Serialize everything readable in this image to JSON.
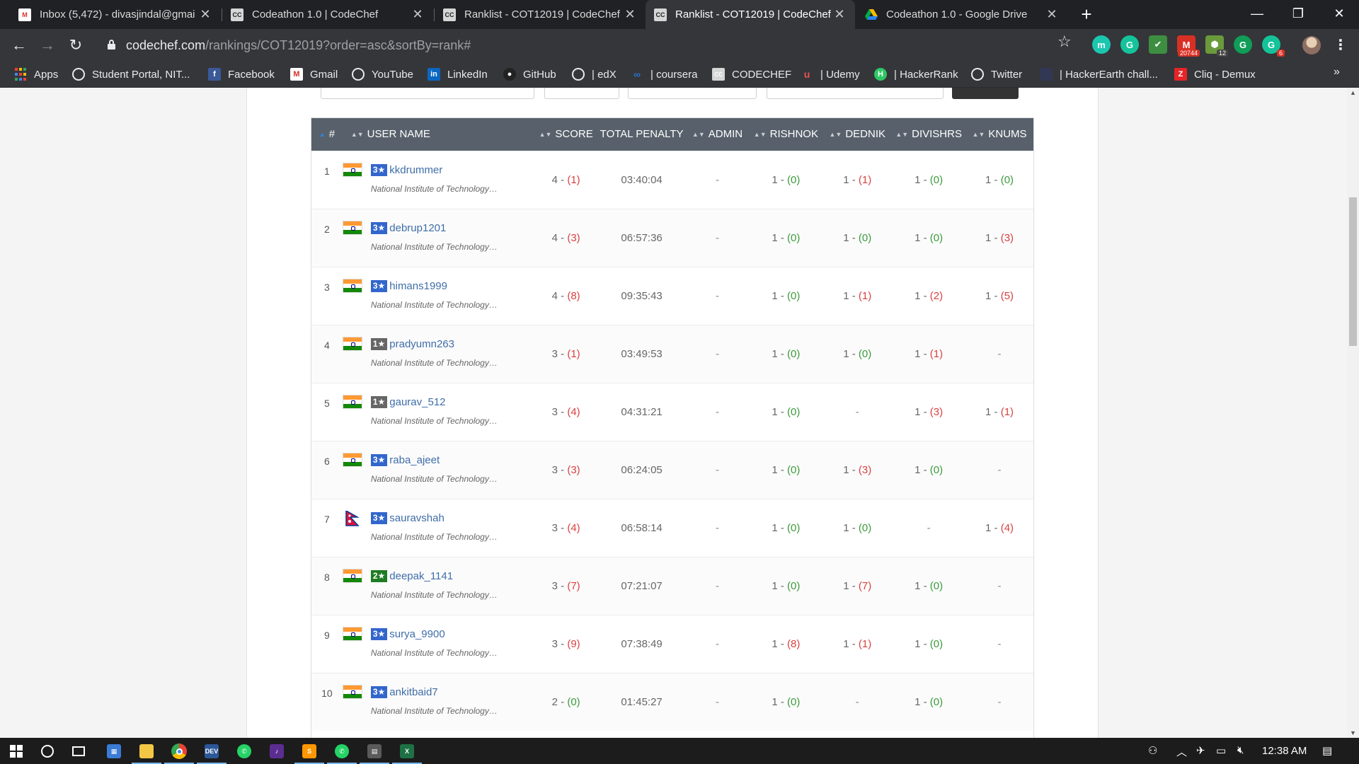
{
  "browser": {
    "tabs": [
      {
        "title": "Inbox (5,472) - divasjindal@gmai",
        "icon": "gmail-icon",
        "active": false
      },
      {
        "title": "Codeathon 1.0 | CodeChef",
        "icon": "codechef-icon",
        "active": false
      },
      {
        "title": "Ranklist - COT12019 | CodeChef",
        "icon": "codechef-icon",
        "active": false
      },
      {
        "title": "Ranklist - COT12019 | CodeChef",
        "icon": "codechef-icon",
        "active": true
      },
      {
        "title": "Codeathon 1.0 - Google Drive",
        "icon": "google-drive-icon",
        "active": false
      }
    ],
    "url_host": "codechef.com",
    "url_path": "/rankings/COT12019?order=asc&sortBy=rank#",
    "extension_badges": {
      "mail": "20744",
      "shield": "12",
      "grammarly": "6"
    },
    "bookmarks": [
      "Apps",
      "Student Portal, NIT...",
      "Facebook",
      "Gmail",
      "YouTube",
      "LinkedIn",
      "GitHub",
      "| edX",
      "| coursera",
      "CODECHEF",
      "| Udemy",
      "| HackerRank",
      "Twitter",
      "| HackerEarth  chall...",
      "Cliq - Demux"
    ]
  },
  "ranklist": {
    "headers": {
      "rank": "#",
      "user": "USER NAME",
      "score": "SCORE",
      "penalty": "TOTAL PENALTY",
      "p1": "ADMIN",
      "p2": "RISHNOK",
      "p3": "DEDNIK",
      "p4": "DIVISHRS",
      "p5": "KNUMS"
    },
    "rows": [
      {
        "rank": "1",
        "flag": "india",
        "stars": "3★",
        "star_color": "#3366cc",
        "user": "kkdrummer",
        "inst": "National Institute of Technology…",
        "score": [
          "4",
          "(1)",
          "r"
        ],
        "penalty": "03:40:04",
        "p1": [
          "-",
          "",
          "d"
        ],
        "p2": [
          "1",
          "(0)",
          "g"
        ],
        "p3": [
          "1",
          "(1)",
          "r"
        ],
        "p4": [
          "1",
          "(0)",
          "g"
        ],
        "p5": [
          "1",
          "(0)",
          "g"
        ]
      },
      {
        "rank": "2",
        "flag": "india",
        "stars": "3★",
        "star_color": "#3366cc",
        "user": "debrup1201",
        "inst": "National Institute of Technology…",
        "score": [
          "4",
          "(3)",
          "r"
        ],
        "penalty": "06:57:36",
        "p1": [
          "-",
          "",
          "d"
        ],
        "p2": [
          "1",
          "(0)",
          "g"
        ],
        "p3": [
          "1",
          "(0)",
          "g"
        ],
        "p4": [
          "1",
          "(0)",
          "g"
        ],
        "p5": [
          "1",
          "(3)",
          "r"
        ]
      },
      {
        "rank": "3",
        "flag": "india",
        "stars": "3★",
        "star_color": "#3366cc",
        "user": "himans1999",
        "inst": "National Institute of Technology…",
        "score": [
          "4",
          "(8)",
          "r"
        ],
        "penalty": "09:35:43",
        "p1": [
          "-",
          "",
          "d"
        ],
        "p2": [
          "1",
          "(0)",
          "g"
        ],
        "p3": [
          "1",
          "(1)",
          "r"
        ],
        "p4": [
          "1",
          "(2)",
          "r"
        ],
        "p5": [
          "1",
          "(5)",
          "r"
        ]
      },
      {
        "rank": "4",
        "flag": "india",
        "stars": "1★",
        "star_color": "#666666",
        "user": "pradyumn263",
        "inst": "National Institute of Technology…",
        "score": [
          "3",
          "(1)",
          "r"
        ],
        "penalty": "03:49:53",
        "p1": [
          "-",
          "",
          "d"
        ],
        "p2": [
          "1",
          "(0)",
          "g"
        ],
        "p3": [
          "1",
          "(0)",
          "g"
        ],
        "p4": [
          "1",
          "(1)",
          "r"
        ],
        "p5": [
          "-",
          "",
          "d"
        ]
      },
      {
        "rank": "5",
        "flag": "india",
        "stars": "1★",
        "star_color": "#666666",
        "user": "gaurav_512",
        "inst": "National Institute of Technology…",
        "score": [
          "3",
          "(4)",
          "r"
        ],
        "penalty": "04:31:21",
        "p1": [
          "-",
          "",
          "d"
        ],
        "p2": [
          "1",
          "(0)",
          "g"
        ],
        "p3": [
          "-",
          "",
          "d"
        ],
        "p4": [
          "1",
          "(3)",
          "r"
        ],
        "p5": [
          "1",
          "(1)",
          "r"
        ]
      },
      {
        "rank": "6",
        "flag": "india",
        "stars": "3★",
        "star_color": "#3366cc",
        "user": "raba_ajeet",
        "inst": "National Institute of Technology…",
        "score": [
          "3",
          "(3)",
          "r"
        ],
        "penalty": "06:24:05",
        "p1": [
          "-",
          "",
          "d"
        ],
        "p2": [
          "1",
          "(0)",
          "g"
        ],
        "p3": [
          "1",
          "(3)",
          "r"
        ],
        "p4": [
          "1",
          "(0)",
          "g"
        ],
        "p5": [
          "-",
          "",
          "d"
        ]
      },
      {
        "rank": "7",
        "flag": "nepal",
        "stars": "3★",
        "star_color": "#3366cc",
        "user": "sauravshah",
        "inst": "National Institute of Technology…",
        "score": [
          "3",
          "(4)",
          "r"
        ],
        "penalty": "06:58:14",
        "p1": [
          "-",
          "",
          "d"
        ],
        "p2": [
          "1",
          "(0)",
          "g"
        ],
        "p3": [
          "1",
          "(0)",
          "g"
        ],
        "p4": [
          "-",
          "",
          "d"
        ],
        "p5": [
          "1",
          "(4)",
          "r"
        ]
      },
      {
        "rank": "8",
        "flag": "india",
        "stars": "2★",
        "star_color": "#1e7d22",
        "user": "deepak_1141",
        "inst": "National Institute of Technology…",
        "score": [
          "3",
          "(7)",
          "r"
        ],
        "penalty": "07:21:07",
        "p1": [
          "-",
          "",
          "d"
        ],
        "p2": [
          "1",
          "(0)",
          "g"
        ],
        "p3": [
          "1",
          "(7)",
          "r"
        ],
        "p4": [
          "1",
          "(0)",
          "g"
        ],
        "p5": [
          "-",
          "",
          "d"
        ]
      },
      {
        "rank": "9",
        "flag": "india",
        "stars": "3★",
        "star_color": "#3366cc",
        "user": "surya_9900",
        "inst": "National Institute of Technology…",
        "score": [
          "3",
          "(9)",
          "r"
        ],
        "penalty": "07:38:49",
        "p1": [
          "-",
          "",
          "d"
        ],
        "p2": [
          "1",
          "(8)",
          "r"
        ],
        "p3": [
          "1",
          "(1)",
          "r"
        ],
        "p4": [
          "1",
          "(0)",
          "g"
        ],
        "p5": [
          "-",
          "",
          "d"
        ]
      },
      {
        "rank": "10",
        "flag": "india",
        "stars": "3★",
        "star_color": "#3366cc",
        "user": "ankitbaid7",
        "inst": "National Institute of Technology…",
        "score": [
          "2",
          "(0)",
          "g"
        ],
        "penalty": "01:45:27",
        "p1": [
          "-",
          "",
          "d"
        ],
        "p2": [
          "1",
          "(0)",
          "g"
        ],
        "p3": [
          "-",
          "",
          "d"
        ],
        "p4": [
          "1",
          "(0)",
          "g"
        ],
        "p5": [
          "-",
          "",
          "d"
        ]
      }
    ]
  },
  "taskbar": {
    "time": "12:38 AM"
  }
}
